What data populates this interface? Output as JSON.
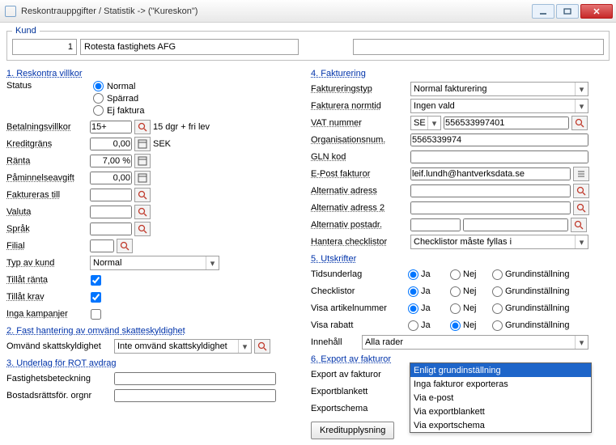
{
  "window": {
    "title": "Reskontrauppgifter / Statistik   ->  (\"Kureskon\")"
  },
  "kund": {
    "legend": "Kund",
    "id": "1",
    "name": "Rotesta fastighets AFG",
    "extra": ""
  },
  "reskon": {
    "title": "1. Reskontra villkor",
    "status_label": "Status",
    "status_normal": "Normal",
    "status_sparrad": "Spärrad",
    "status_ejfaktura": "Ej faktura",
    "betal": "Betalningsvillkor",
    "betal_val": "15+",
    "betal_hint": "15 dgr + fri lev",
    "kredit": "Kreditgräns",
    "kredit_val": "0,00",
    "kredit_unit": "SEK",
    "ranta": "Ränta",
    "ranta_val": "7,00 %",
    "pamin": "Påminnelseavgift",
    "pamin_val": "0,00",
    "faktill": "Faktureras till",
    "valuta": "Valuta",
    "sprak": "Språk",
    "filial": "Filial",
    "typkund": "Typ av kund",
    "typkund_val": "Normal",
    "tillranta": "Tillåt ränta",
    "tillkrav": "Tillåt krav",
    "ingakamp": "Inga kampanjer"
  },
  "omv": {
    "title": "2. Fast hantering av omvänd skatteskyldighet",
    "label": "Omvänd skattskyldighet",
    "value": "Inte omvänd skattskyldighet"
  },
  "rot": {
    "title": "3. Underlag för ROT avdrag",
    "fastighet": "Fastighetsbeteckning",
    "bostad": "Bostadsrättsför. orgnr"
  },
  "fakt": {
    "title": "4. Fakturering",
    "typ": "Faktureringstyp",
    "typ_val": "Normal fakturering",
    "normtid": "Fakturera normtid",
    "normtid_val": "Ingen vald",
    "vat": "VAT nummer",
    "vat_cc": "SE",
    "vat_val": "556533997401",
    "orgnr": "Organisationsnum.",
    "orgnr_val": "5565339974",
    "gln": "GLN kod",
    "epost": "E-Post fakturor",
    "epost_val": "leif.lundh@hantverksdata.se",
    "altadr": "Alternativ adress",
    "altadr2": "Alternativ adress 2",
    "altpost": "Alternativ postadr.",
    "checklist": "Hantera checklistor",
    "checklist_val": "Checklistor måste fyllas i"
  },
  "utskr": {
    "title": "5. Utskrifter",
    "ja": "Ja",
    "nej": "Nej",
    "grund": "Grundinställning",
    "tid": "Tidsunderlag",
    "check": "Checklistor",
    "visa_art": "Visa artikelnummer",
    "visa_rab": "Visa rabatt",
    "innehall": "Innehåll",
    "innehall_val": "Alla rader"
  },
  "export": {
    "title": "6. Export av fakturor",
    "export_av": "Export av fakturor",
    "export_val": "Enligt grundinställning",
    "blankett": "Exportblankett",
    "schema": "Exportschema",
    "options": [
      "Enligt grundinställning",
      "Inga fakturor exporteras",
      "Via e-post",
      "Via exportblankett",
      "Via exportschema"
    ]
  },
  "kreditupp": "Kreditupplysning"
}
